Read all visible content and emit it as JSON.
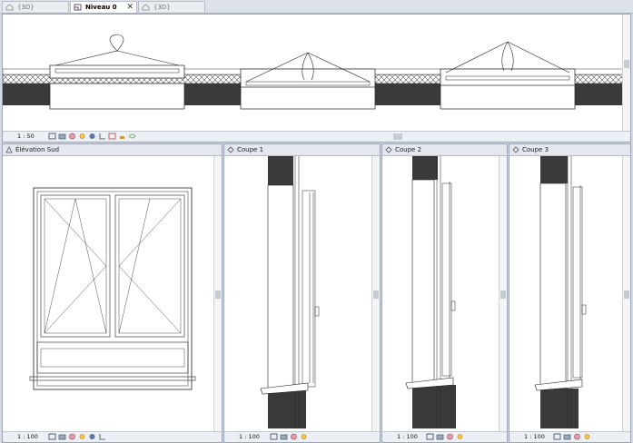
{
  "tabs": [
    {
      "label": "{3D}",
      "active": false
    },
    {
      "label": "Niveau 0",
      "active": true
    },
    {
      "label": "{3D}",
      "active": false
    }
  ],
  "plan_view": {
    "scale": "1 : 50"
  },
  "panels": [
    {
      "title": "Élévation Sud",
      "scale": "1 : 100"
    },
    {
      "title": "Coupe 1",
      "scale": "1 : 100"
    },
    {
      "title": "Coupe 2",
      "scale": "1 : 100"
    },
    {
      "title": "Coupe 3",
      "scale": "1 : 100"
    }
  ],
  "icons": {
    "view_controls": [
      "sheet-icon",
      "detail-level-icon",
      "visual-style-icon",
      "sun-path-icon",
      "shadows-icon",
      "crop-icon",
      "show-crop-icon",
      "lock-3d-icon",
      "temporary-hide-icon",
      "reveal-hidden-icon",
      "worksharing-icon"
    ],
    "close": "✕"
  },
  "colors": {
    "wall_dark": "#3a3a3a",
    "hatch": "#555555"
  }
}
